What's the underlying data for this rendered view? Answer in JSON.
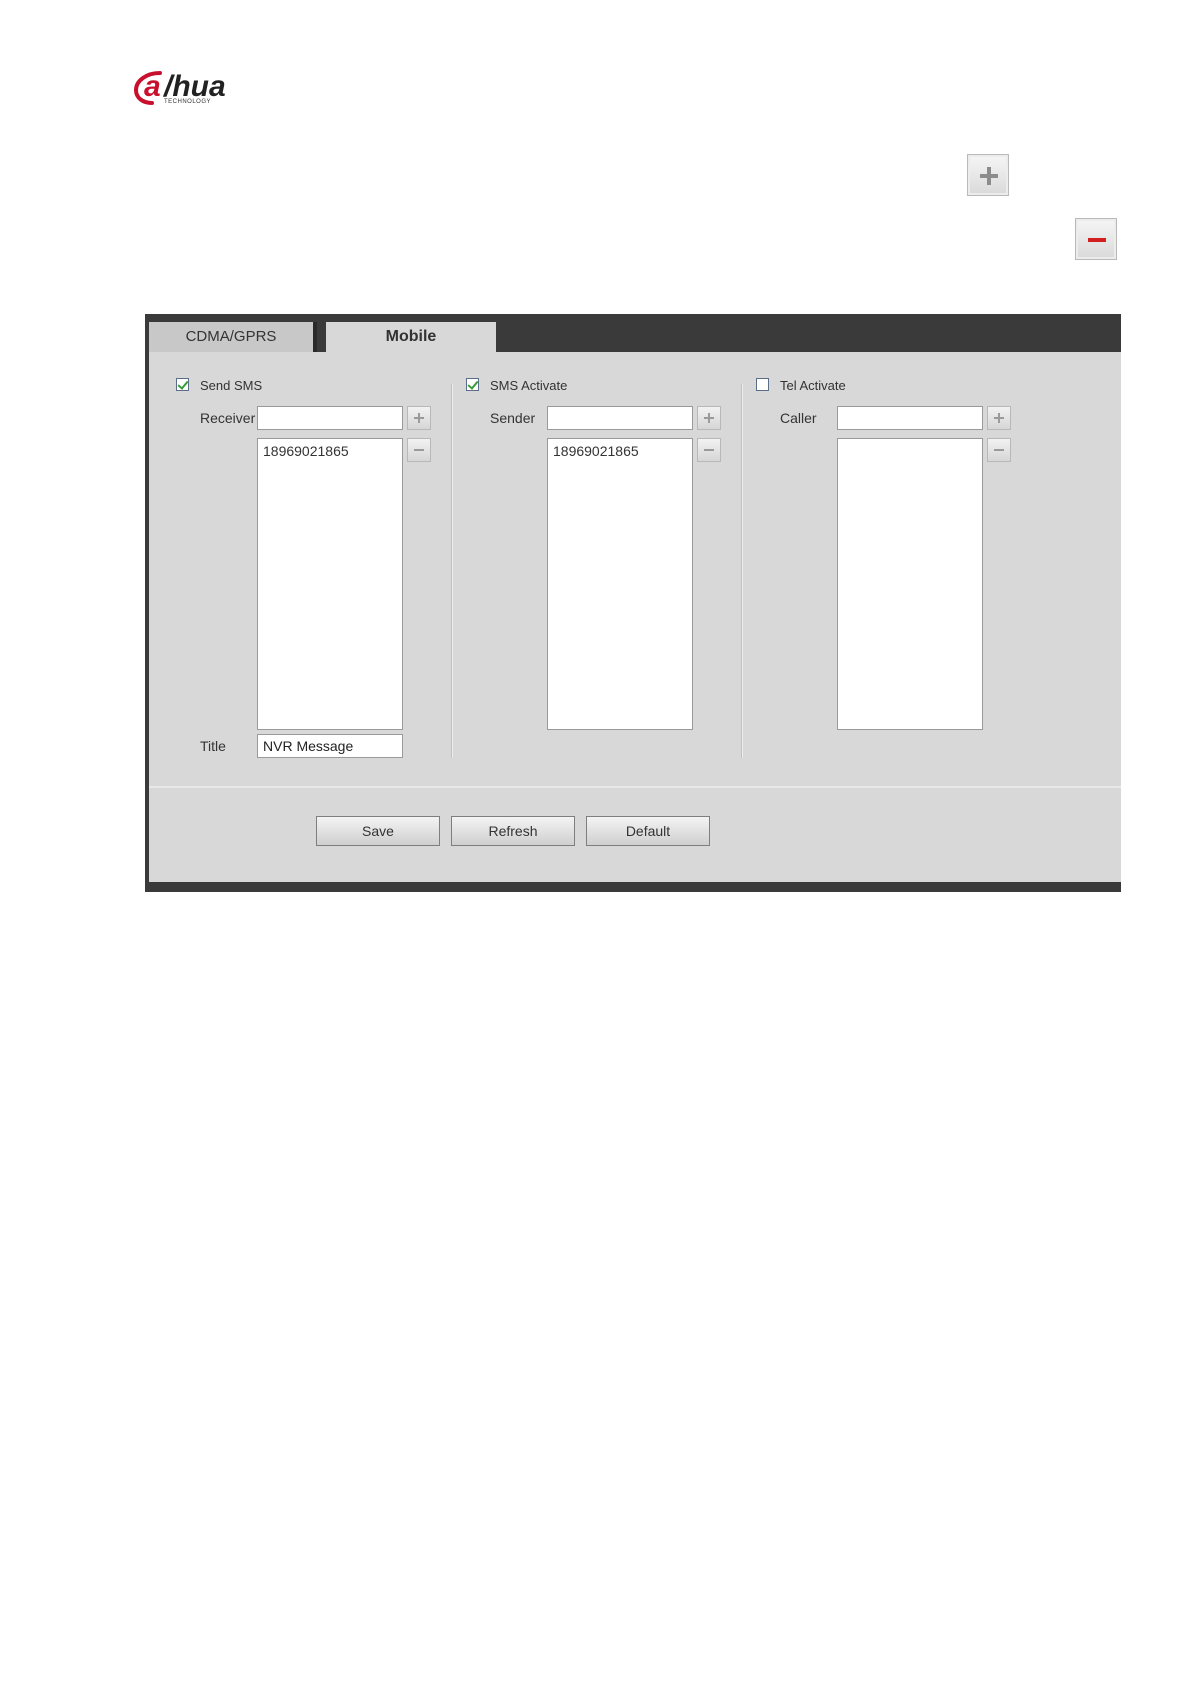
{
  "logo": {
    "brand": "alhua",
    "sub": "TECHNOLOGY"
  },
  "icons": {
    "add": "plus-icon",
    "delete": "minus-icon"
  },
  "colors": {
    "panel_dark": "#3a3a3a",
    "panel_bg": "#d8d8d8",
    "check_green": "#3a9a3a",
    "delete_red": "#d21f1f",
    "logo_red": "#c8102e"
  },
  "tabs": [
    {
      "label": "CDMA/GPRS",
      "active": false
    },
    {
      "label": "Mobile",
      "active": true
    }
  ],
  "send_sms": {
    "label": "Send SMS",
    "checked": true,
    "receiver_label": "Receiver",
    "receiver_value": "",
    "list": [
      "18969021865"
    ],
    "title_label": "Title",
    "title_value": "NVR Message"
  },
  "sms_activate": {
    "label": "SMS Activate",
    "checked": true,
    "sender_label": "Sender",
    "sender_value": "",
    "list": [
      "18969021865"
    ]
  },
  "tel_activate": {
    "label": "Tel Activate",
    "checked": false,
    "caller_label": "Caller",
    "caller_value": "",
    "list": []
  },
  "buttons": {
    "save": "Save",
    "refresh": "Refresh",
    "default": "Default"
  }
}
